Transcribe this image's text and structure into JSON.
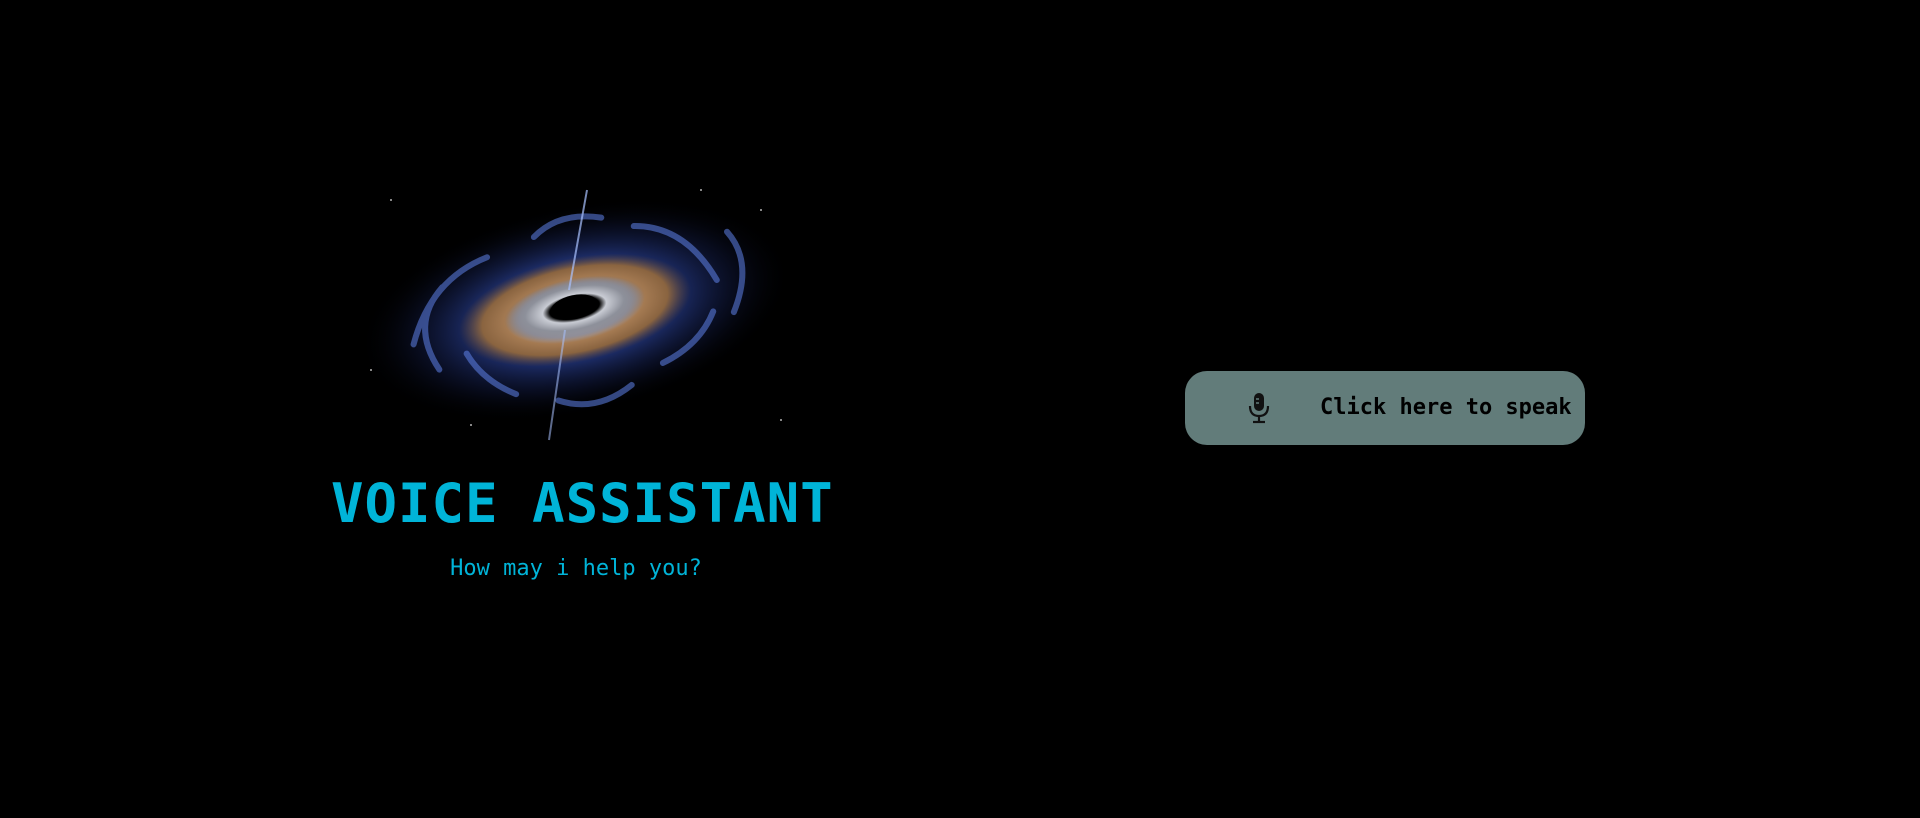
{
  "hero": {
    "image": "black-hole-image",
    "title": "VOICE ASSISTANT",
    "subtitle": "How may i help you?"
  },
  "speak_button": {
    "icon": "microphone-icon",
    "label": "Click here to speak"
  },
  "colors": {
    "background": "#000000",
    "accent": "#00b4d8",
    "button_bg": "#627c7a",
    "button_text": "#000000"
  }
}
